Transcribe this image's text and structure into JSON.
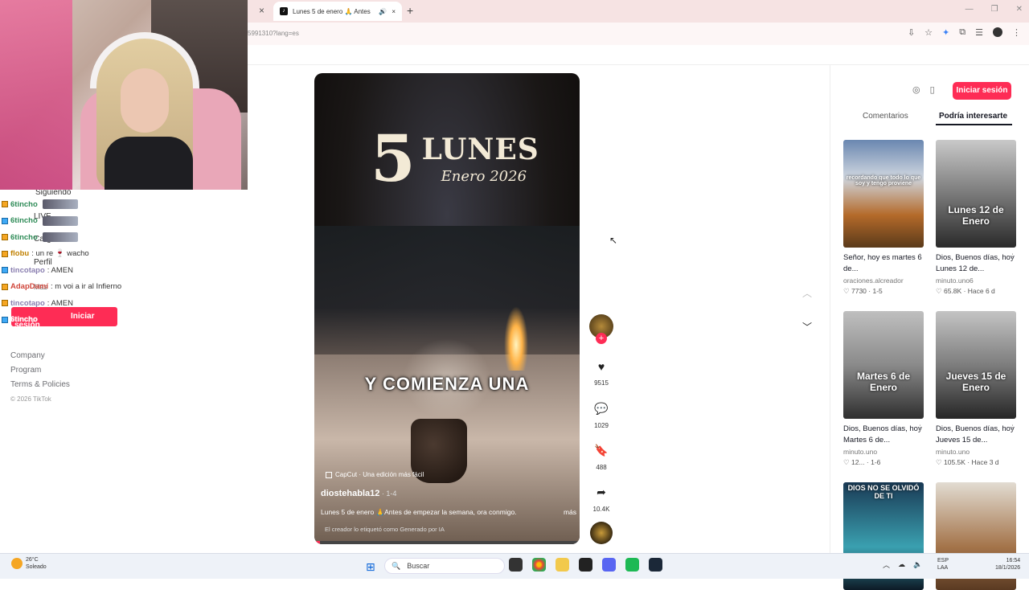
{
  "browser": {
    "active_tab_title": "Lunes 5 de enero 🙏 Antes",
    "url": "5991310?lang=es",
    "new_tab_label": "+",
    "close_label": "×"
  },
  "sidebar": {
    "following": "Siguiendo",
    "live": "LIVE",
    "upload": "Cargar",
    "profile": "Perfil",
    "more": "Más",
    "login": "Iniciar sesión",
    "footer": [
      "Company",
      "Program",
      "Terms & Policies"
    ],
    "copyright": "© 2026 TikTok"
  },
  "chat": [
    {
      "user": "6tincho",
      "color": "#2e8b57",
      "msg": ""
    },
    {
      "user": "6tincho",
      "color": "#2e8b57",
      "msg": ""
    },
    {
      "user": "6tincho",
      "color": "#2e8b57",
      "msg": ""
    },
    {
      "user": "flobu",
      "color": "#c08000",
      "msg": ": un re 🍷 wacho"
    },
    {
      "user": "tincotapo",
      "color": "#8a7fb0",
      "msg": ": AMEN"
    },
    {
      "user": "AdapDamí",
      "color": "#d0453a",
      "msg": ": m voi a ir al Infierno"
    },
    {
      "user": "tincotapo",
      "color": "#8a7fb0",
      "msg": ": AMEN"
    },
    {
      "user": "6tincho",
      "color": "#ffffff",
      "msg": ""
    }
  ],
  "video": {
    "number": "5",
    "title": "LUNES",
    "subtitle": "Enero 2026",
    "overlay_caption": "Y COMIENZA UNA",
    "capcut": "CapCut · Una edición más fácil",
    "author": "diostehabla12",
    "date": " · 1-4",
    "description": "Lunes 5 de enero 🙏Antes de empezar la semana, ora conmigo.",
    "more": "más",
    "ai_label": "El creador lo etiquetó como Generado por IA",
    "progress": 0.02
  },
  "actions": {
    "likes": "9515",
    "comments": "1029",
    "saves": "488",
    "shares": "10.4K"
  },
  "right_panel": {
    "login": "Iniciar sesión",
    "tabs": [
      "Comentarios",
      "Podría interesarte"
    ],
    "cards": [
      {
        "thumb_text": "recordando que todo lo que soy y tengo proviene",
        "title": "Señor, hoy es martes 6 de...",
        "author": "oraciones.alcreador",
        "likes": "7730",
        "date": "1-5"
      },
      {
        "thumb_text": "Lunes 12 de Enero",
        "title": "Dios, Buenos días, hoy Lunes 12 de...",
        "author": "minuto.uno6",
        "likes": "65.8K",
        "date": "Hace 6 d"
      },
      {
        "thumb_text": "Martes 6 de Enero",
        "title": "Dios, Buenos días, hoy Martes 6 de...",
        "author": "minuto.uno",
        "likes": "12...",
        "date": "1-6"
      },
      {
        "thumb_text": "Jueves 15 de Enero",
        "title": "Dios, Buenos días, hoy Jueves 15 de...",
        "author": "minuto.uno",
        "likes": "105.5K",
        "date": "Hace 3 d"
      },
      {
        "thumb_text": "DIOS NO SE OLVIDÓ DE TI",
        "title": "",
        "author": "",
        "likes": "",
        "date": ""
      },
      {
        "thumb_text": "",
        "title": "",
        "author": "",
        "likes": "",
        "date": ""
      }
    ]
  },
  "taskbar": {
    "temp": "26°C",
    "weather": "Soleado",
    "search": "Buscar",
    "lang1": "ESP",
    "lang2": "LAA",
    "time": "16:54",
    "date": "18/1/2026"
  }
}
